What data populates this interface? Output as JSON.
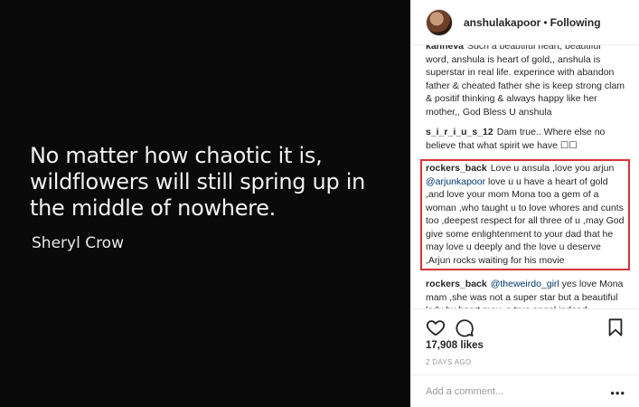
{
  "photo": {
    "quote": "No matter how chaotic it is, wildflowers will still spring up in the middle of nowhere.",
    "author": "Sheryl Crow"
  },
  "header": {
    "username": "anshulakapoor",
    "separator": "•",
    "follow_status": "Following"
  },
  "comments": [
    {
      "user": "kanneva",
      "text": "Such a beautiful heart, beautiful word, anshula is heart of gold,, anshula is superstar in real life. experince with abandon father & cheated father she is keep strong clam & positif thinking & always happy like her mother,, God Bless U anshula"
    },
    {
      "user": "s_i_r_i_u_s_12",
      "text": "Dam true.. Where else no believe that what spirit we have ☐☐"
    },
    {
      "user": "rockers_back",
      "text_before": "Love u ansula ,love you arjun ",
      "mention": "@arjunkapoor",
      "text_after": " love u u have a heart of gold ,and love your mom Mona too a gem of a woman ,who taught u to love whores and cunts too ,deepest respect for all three of u ,may God give some enlightenment to your dad that he may love u deeply and the love u deserve ,Arjun rocks waiting for his movie"
    },
    {
      "user": "rockers_back",
      "mention": "@theweirdo_girl",
      "text_after": " yes love Mona mam ,she was not a super star but a beautiful lady by heart may ,a true angel indeed"
    }
  ],
  "likes": "17,908 likes",
  "date": "2 DAYS AGO",
  "add_comment": {
    "placeholder": "Add a comment...",
    "more": "•••"
  }
}
